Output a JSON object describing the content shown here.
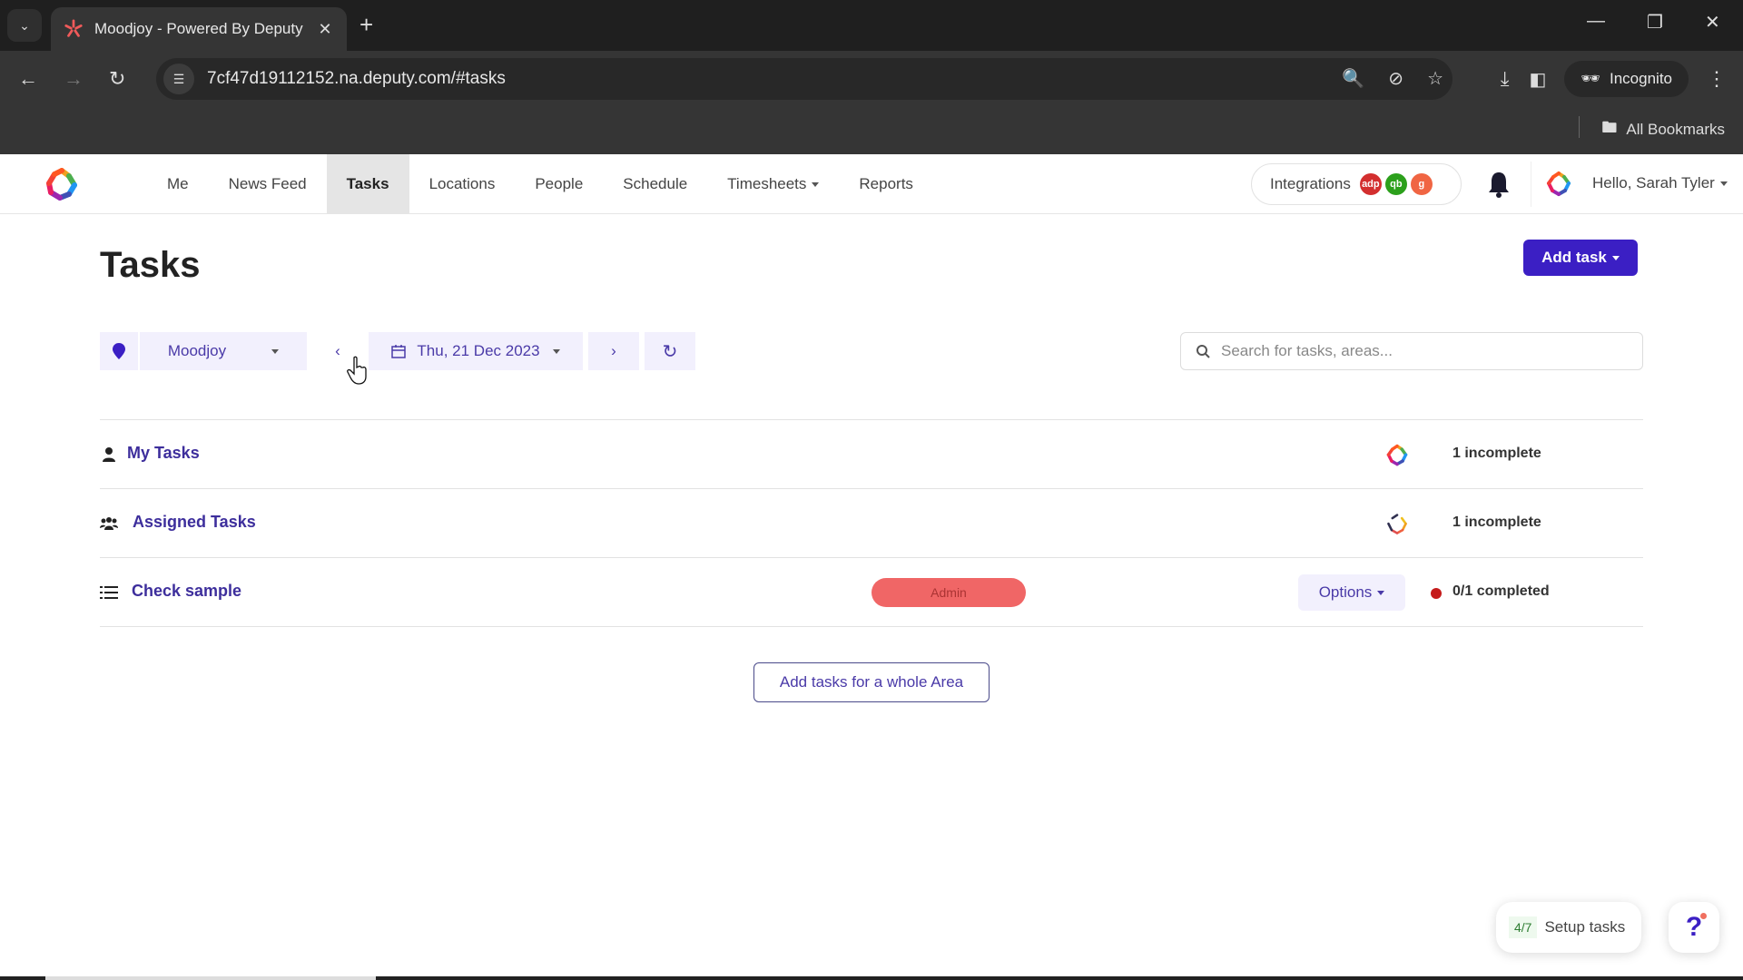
{
  "browser": {
    "tab_title": "Moodjoy - Powered By Deputy",
    "url": "7cf47d19112152.na.deputy.com/#tasks",
    "incognito_label": "Incognito",
    "bookmarks_label": "All Bookmarks",
    "icons": [
      "tab-list-icon",
      "close-icon",
      "plus-icon",
      "back-icon",
      "forward-icon",
      "reload-icon",
      "site-info-icon",
      "zoom-icon",
      "eye-off-icon",
      "star-icon",
      "download-icon",
      "sidepanel-icon",
      "incognito-icon",
      "menu-icon",
      "folder-icon",
      "minimize-icon",
      "restore-icon",
      "window-close-icon"
    ]
  },
  "nav": {
    "items": [
      {
        "label": "Me",
        "active": false
      },
      {
        "label": "News Feed",
        "active": false
      },
      {
        "label": "Tasks",
        "active": true
      },
      {
        "label": "Locations",
        "active": false
      },
      {
        "label": "People",
        "active": false
      },
      {
        "label": "Schedule",
        "active": false
      },
      {
        "label": "Timesheets",
        "active": false,
        "dropdown": true
      },
      {
        "label": "Reports",
        "active": false
      }
    ],
    "integrations_label": "Integrations",
    "integration_badges": [
      {
        "label": "adp",
        "color": "#d32f2f"
      },
      {
        "label": "qb",
        "color": "#2ca01c"
      },
      {
        "label": "g",
        "color": "#f06543"
      }
    ],
    "greeting": "Hello, Sarah Tyler"
  },
  "page": {
    "title": "Tasks",
    "add_task_label": "Add task",
    "location": "Moodjoy",
    "date": "Thu, 21 Dec 2023",
    "search_placeholder": "Search for tasks, areas...",
    "search_value": ""
  },
  "rows": [
    {
      "label": "My Tasks",
      "icon": "user-icon",
      "status": "1 incomplete"
    },
    {
      "label": "Assigned Tasks",
      "icon": "users-icon",
      "status": "1 incomplete"
    },
    {
      "label": "Check sample",
      "icon": "list-icon",
      "badge": "Admin",
      "options_label": "Options",
      "status": "0/1 completed",
      "status_color": "#c51b1b"
    }
  ],
  "add_area_label": "Add tasks for a whole Area",
  "setup": {
    "count": "4/7",
    "label": "Setup tasks"
  },
  "help_label": "?",
  "colors": {
    "brand": "#3b1fc4",
    "link": "#3d2e9c",
    "admin_badge": "#f06666"
  }
}
